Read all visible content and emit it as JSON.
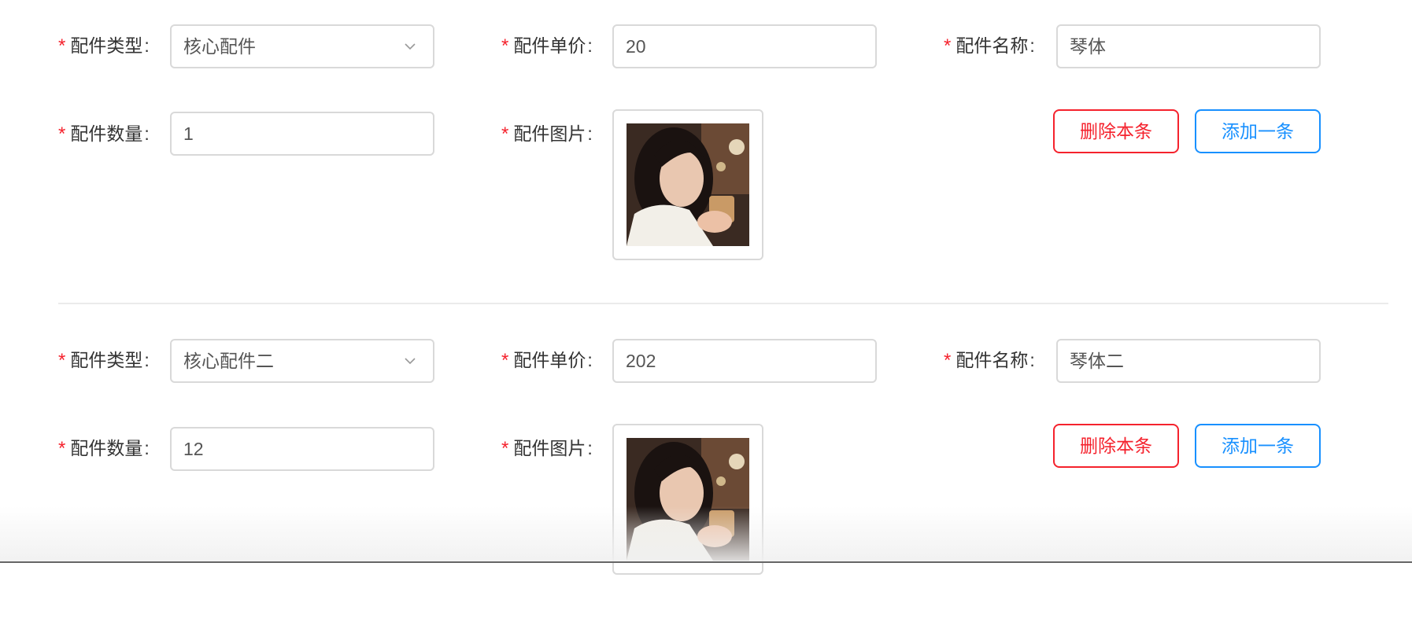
{
  "labels": {
    "type": "配件类型",
    "price": "配件单价",
    "name": "配件名称",
    "quantity": "配件数量",
    "image": "配件图片",
    "required_mark": "*",
    "colon": ":"
  },
  "buttons": {
    "delete": "删除本条",
    "add": "添加一条"
  },
  "items": [
    {
      "type": "核心配件",
      "price": "20",
      "name": "琴体",
      "quantity": "1"
    },
    {
      "type": "核心配件二",
      "price": "202",
      "name": "琴体二",
      "quantity": "12"
    }
  ],
  "colors": {
    "required": "#f5222d",
    "delete": "#f5222d",
    "add": "#1890ff",
    "border": "#d9d9d9"
  },
  "icons": [
    "chevron-down-icon",
    "part-photo"
  ]
}
